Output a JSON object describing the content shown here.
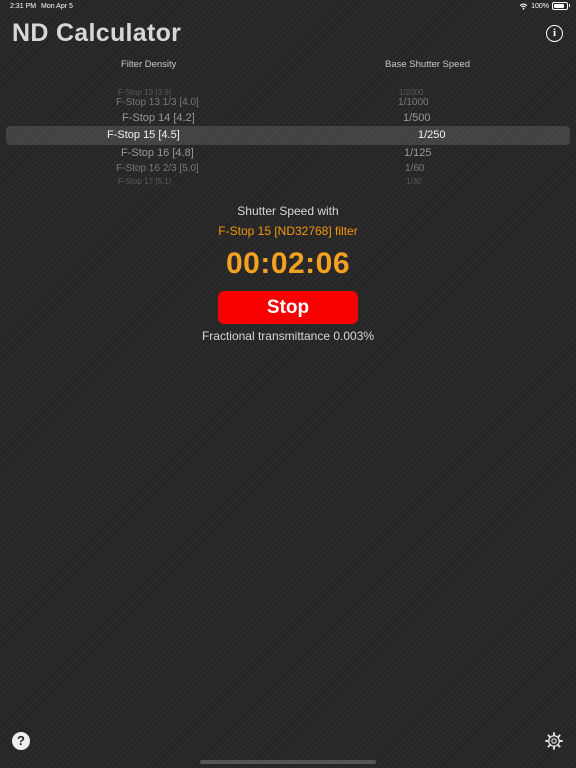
{
  "status_bar": {
    "time": "2:31 PM",
    "date": "Mon Apr 5",
    "battery": "100%",
    "battery_level": 1.0
  },
  "header": {
    "title": "ND Calculator",
    "info_icon": "info-icon"
  },
  "picker": {
    "col_density": "Filter Density",
    "col_speed": "Base Shutter Speed",
    "density_rows": [
      "F-Stop 13 [3.9]",
      "F-Stop 13 1/3 [4.0]",
      "F-Stop 14 [4.2]",
      "F-Stop 15 [4.5]",
      "F-Stop 16 [4.8]",
      "F-Stop 16 2/3 [5.0]",
      "F-Stop 17 [5.1]"
    ],
    "speed_rows": [
      "1/2000",
      "1/1000",
      "1/500",
      "1/250",
      "1/125",
      "1/60",
      "1/30"
    ]
  },
  "result": {
    "label": "Shutter Speed with",
    "filter": "F-Stop 15 [ND32768] filter",
    "timer": "00:02:06",
    "stop_label": "Stop",
    "transmittance": "Fractional transmittance 0.003%"
  },
  "footer": {
    "help_icon": "help-icon",
    "settings_icon": "gear-icon"
  }
}
